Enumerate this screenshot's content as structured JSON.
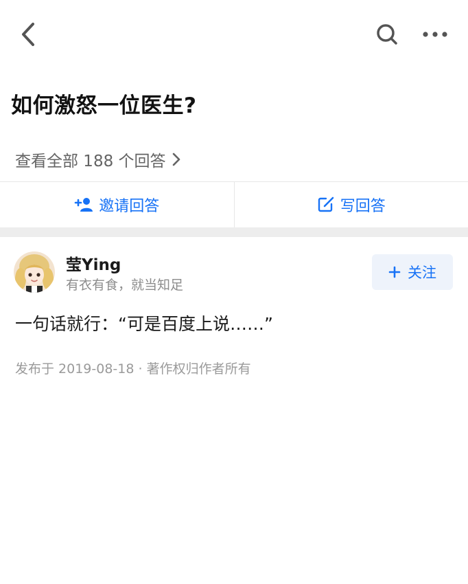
{
  "nav": {
    "back_icon": "chevron-left-icon",
    "search_icon": "search-icon",
    "more_icon": "more-horizontal-icon"
  },
  "question": {
    "title": "如何激怒一位医生?",
    "view_all_label": "查看全部 188 个回答"
  },
  "actions": {
    "invite_label": "邀请回答",
    "write_label": "写回答"
  },
  "answer": {
    "author_name": "莹Ying",
    "author_bio": "有衣有食，就当知足",
    "follow_label": "关注",
    "content": "一句话就行：“可是百度上说……”",
    "meta": "发布于 2019-08-18 · 著作权归作者所有"
  },
  "colors": {
    "accent": "#1772f6",
    "secondary_text": "#646464",
    "muted_text": "#9a9a9a",
    "divider": "#e6e6e6",
    "band": "#ededed",
    "follow_bg": "#eef3fb"
  }
}
